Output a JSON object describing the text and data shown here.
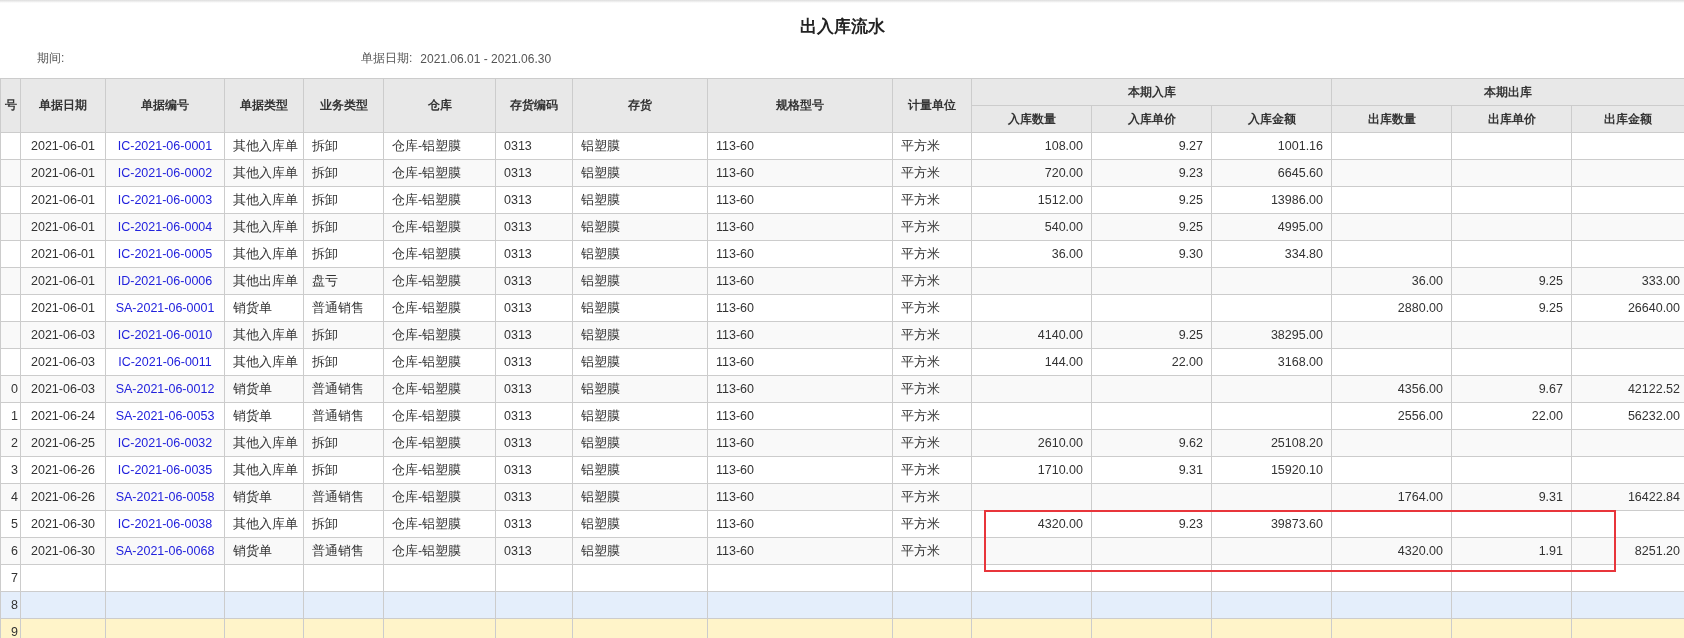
{
  "report": {
    "title": "出入库流水",
    "period_label": "期间:",
    "date_label": "单据日期:",
    "date_value": "2021.06.01 - 2021.06.30"
  },
  "columns": [
    {
      "label": "号"
    },
    {
      "label": "单据日期"
    },
    {
      "label": "单据编号"
    },
    {
      "label": "单据类型"
    },
    {
      "label": "业务类型"
    },
    {
      "label": "仓库"
    },
    {
      "label": "存货编码"
    },
    {
      "label": "存货"
    },
    {
      "label": "规格型号"
    },
    {
      "label": "计量单位"
    },
    {
      "label": "本期入库",
      "children": [
        {
          "label": "入库数量"
        },
        {
          "label": "入库单价"
        },
        {
          "label": "入库金额"
        }
      ]
    },
    {
      "label": "本期出库",
      "children": [
        {
          "label": "出库数量"
        },
        {
          "label": "出库单价"
        },
        {
          "label": "出库金额"
        }
      ]
    }
  ],
  "rows": [
    {
      "selected": false,
      "hovered": false,
      "date": "2021-06-01",
      "doc_no": "IC-2021-06-0001",
      "doc_type": "其他入库单",
      "biz_type": "拆卸",
      "warehouse": "仓库-铝塑膜",
      "item_code": "0313",
      "item": "铝塑膜",
      "spec": "113-60",
      "unit": "平方米",
      "in_qty": "108.00",
      "in_price": "9.27",
      "in_amount": "1001.16"
    },
    {
      "selected": false,
      "hovered": false,
      "date": "2021-06-01",
      "doc_no": "IC-2021-06-0002",
      "doc_type": "其他入库单",
      "biz_type": "拆卸",
      "warehouse": "仓库-铝塑膜",
      "item_code": "0313",
      "item": "铝塑膜",
      "spec": "113-60",
      "unit": "平方米",
      "in_qty": "720.00",
      "in_price": "9.23",
      "in_amount": "6645.60"
    },
    {
      "selected": false,
      "hovered": false,
      "date": "2021-06-01",
      "doc_no": "IC-2021-06-0003",
      "doc_type": "其他入库单",
      "biz_type": "拆卸",
      "warehouse": "仓库-铝塑膜",
      "item_code": "0313",
      "item": "铝塑膜",
      "spec": "113-60",
      "unit": "平方米",
      "in_qty": "1512.00",
      "in_price": "9.25",
      "in_amount": "13986.00"
    },
    {
      "selected": false,
      "hovered": false,
      "date": "2021-06-01",
      "doc_no": "IC-2021-06-0004",
      "doc_type": "其他入库单",
      "biz_type": "拆卸",
      "warehouse": "仓库-铝塑膜",
      "item_code": "0313",
      "item": "铝塑膜",
      "spec": "113-60",
      "unit": "平方米",
      "in_qty": "540.00",
      "in_price": "9.25",
      "in_amount": "4995.00"
    },
    {
      "selected": false,
      "hovered": false,
      "date": "2021-06-01",
      "doc_no": "IC-2021-06-0005",
      "doc_type": "其他入库单",
      "biz_type": "拆卸",
      "warehouse": "仓库-铝塑膜",
      "item_code": "0313",
      "item": "铝塑膜",
      "spec": "113-60",
      "unit": "平方米",
      "in_qty": "36.00",
      "in_price": "9.30",
      "in_amount": "334.80"
    },
    {
      "selected": false,
      "hovered": false,
      "date": "2021-06-01",
      "doc_no": "ID-2021-06-0006",
      "doc_type": "其他出库单",
      "biz_type": "盘亏",
      "warehouse": "仓库-铝塑膜",
      "item_code": "0313",
      "item": "铝塑膜",
      "spec": "113-60",
      "unit": "平方米",
      "out_qty": "36.00",
      "out_price": "9.25",
      "out_amount": "333.00"
    },
    {
      "selected": false,
      "hovered": false,
      "date": "2021-06-01",
      "doc_no": "SA-2021-06-0001",
      "doc_type": "销货单",
      "biz_type": "普通销售",
      "warehouse": "仓库-铝塑膜",
      "item_code": "0313",
      "item": "铝塑膜",
      "spec": "113-60",
      "unit": "平方米",
      "out_qty": "2880.00",
      "out_price": "9.25",
      "out_amount": "26640.00"
    },
    {
      "selected": false,
      "hovered": false,
      "date": "2021-06-03",
      "doc_no": "IC-2021-06-0010",
      "doc_type": "其他入库单",
      "biz_type": "拆卸",
      "warehouse": "仓库-铝塑膜",
      "item_code": "0313",
      "item": "铝塑膜",
      "spec": "113-60",
      "unit": "平方米",
      "in_qty": "4140.00",
      "in_price": "9.25",
      "in_amount": "38295.00"
    },
    {
      "selected": false,
      "hovered": false,
      "date": "2021-06-03",
      "doc_no": "IC-2021-06-0011",
      "doc_type": "其他入库单",
      "biz_type": "拆卸",
      "warehouse": "仓库-铝塑膜",
      "item_code": "0313",
      "item": "铝塑膜",
      "spec": "113-60",
      "unit": "平方米",
      "in_qty": "144.00",
      "in_price": "22.00",
      "in_amount": "3168.00"
    },
    {
      "selected": false,
      "hovered": false,
      "no": "0",
      "date": "2021-06-03",
      "doc_no": "SA-2021-06-0012",
      "doc_type": "销货单",
      "biz_type": "普通销售",
      "warehouse": "仓库-铝塑膜",
      "item_code": "0313",
      "item": "铝塑膜",
      "spec": "113-60",
      "unit": "平方米",
      "out_qty": "4356.00",
      "out_price": "9.67",
      "out_amount": "42122.52"
    },
    {
      "selected": false,
      "hovered": false,
      "no": "1",
      "date": "2021-06-24",
      "doc_no": "SA-2021-06-0053",
      "doc_type": "销货单",
      "biz_type": "普通销售",
      "warehouse": "仓库-铝塑膜",
      "item_code": "0313",
      "item": "铝塑膜",
      "spec": "113-60",
      "unit": "平方米",
      "out_qty": "2556.00",
      "out_price": "22.00",
      "out_amount": "56232.00"
    },
    {
      "selected": false,
      "hovered": false,
      "no": "2",
      "date": "2021-06-25",
      "doc_no": "IC-2021-06-0032",
      "doc_type": "其他入库单",
      "biz_type": "拆卸",
      "warehouse": "仓库-铝塑膜",
      "item_code": "0313",
      "item": "铝塑膜",
      "spec": "113-60",
      "unit": "平方米",
      "in_qty": "2610.00",
      "in_price": "9.62",
      "in_amount": "25108.20"
    },
    {
      "selected": false,
      "hovered": false,
      "no": "3",
      "date": "2021-06-26",
      "doc_no": "IC-2021-06-0035",
      "doc_type": "其他入库单",
      "biz_type": "拆卸",
      "warehouse": "仓库-铝塑膜",
      "item_code": "0313",
      "item": "铝塑膜",
      "spec": "113-60",
      "unit": "平方米",
      "in_qty": "1710.00",
      "in_price": "9.31",
      "in_amount": "15920.10"
    },
    {
      "selected": false,
      "hovered": false,
      "no": "4",
      "date": "2021-06-26",
      "doc_no": "SA-2021-06-0058",
      "doc_type": "销货单",
      "biz_type": "普通销售",
      "warehouse": "仓库-铝塑膜",
      "item_code": "0313",
      "item": "铝塑膜",
      "spec": "113-60",
      "unit": "平方米",
      "out_qty": "1764.00",
      "out_price": "9.31",
      "out_amount": "16422.84"
    },
    {
      "selected": false,
      "hovered": false,
      "no": "5",
      "date": "2021-06-30",
      "doc_no": "IC-2021-06-0038",
      "doc_type": "其他入库单",
      "biz_type": "拆卸",
      "warehouse": "仓库-铝塑膜",
      "item_code": "0313",
      "item": "铝塑膜",
      "spec": "113-60",
      "unit": "平方米",
      "in_qty": "4320.00",
      "in_price": "9.23",
      "in_amount": "39873.60"
    },
    {
      "selected": false,
      "hovered": false,
      "no": "6",
      "date": "2021-06-30",
      "doc_no": "SA-2021-06-0068",
      "doc_type": "销货单",
      "biz_type": "普通销售",
      "warehouse": "仓库-铝塑膜",
      "item_code": "0313",
      "item": "铝塑膜",
      "spec": "113-60",
      "unit": "平方米",
      "out_qty": "4320.00",
      "out_price": "1.91",
      "out_amount": "8251.20"
    },
    {
      "selected": false,
      "hovered": false,
      "no": "7"
    },
    {
      "selected": false,
      "hovered": true,
      "no": "8"
    },
    {
      "selected": true,
      "hovered": false,
      "no": "9"
    }
  ]
}
